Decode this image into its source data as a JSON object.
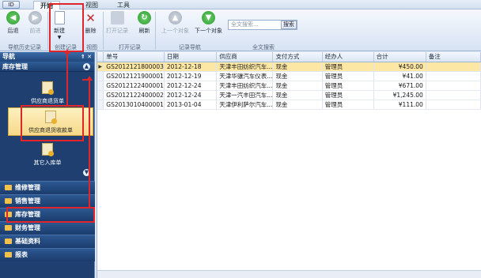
{
  "app": {
    "menu_button": "ID",
    "tabs": [
      "开始",
      "视图",
      "工具"
    ]
  },
  "ribbon": {
    "buttons": {
      "back": "后退",
      "forward": "前进",
      "new": "新建",
      "delete": "删除",
      "open": "打开记录",
      "refresh": "刷新",
      "prev": "上一个对象",
      "next": "下一个对象"
    },
    "search_placeholder": "全文搜索...",
    "search_button": "搜索",
    "groups": [
      "导航历史记录",
      "创建记录",
      "视图",
      "打开记录",
      "记录导航",
      "全文搜索"
    ]
  },
  "sidebar": {
    "title": "导航",
    "controls": "⇑ ✕",
    "section": "库存管理",
    "items": [
      "供应商退货单",
      "供应商退货收款单",
      "其它入库单"
    ],
    "modules": [
      "维修管理",
      "销售管理",
      "库存管理",
      "财务管理",
      "基础资料",
      "报表"
    ]
  },
  "grid": {
    "columns": [
      "",
      "单号",
      "日期",
      "供应商",
      "支付方式",
      "经办人",
      "合计",
      "备注"
    ],
    "rows": [
      [
        "▶",
        "GS2012121800003",
        "2012-12-18",
        "天津丰田纺织汽车...",
        "现金",
        "管理员",
        "¥450.00",
        ""
      ],
      [
        "",
        "GS2012121900001",
        "2012-12-19",
        "天津华骧汽车仪表...",
        "现金",
        "管理员",
        "¥41.00",
        ""
      ],
      [
        "",
        "GS2012122400001",
        "2012-12-24",
        "天津丰田纺织汽车...",
        "现金",
        "管理员",
        "¥671.00",
        ""
      ],
      [
        "",
        "GS2012122400002",
        "2012-12-24",
        "天津一汽丰田汽车...",
        "现金",
        "管理员",
        "¥1,245.00",
        ""
      ],
      [
        "",
        "GS2013010400001",
        "2013-01-04",
        "天津伊利萨尔汽车...",
        "现金",
        "管理员",
        "¥111.00",
        ""
      ]
    ]
  },
  "colors": {
    "annotation": "#e0262a",
    "selected_row": "#fde7a4",
    "sidebar_bg": "#1e3f6f"
  }
}
